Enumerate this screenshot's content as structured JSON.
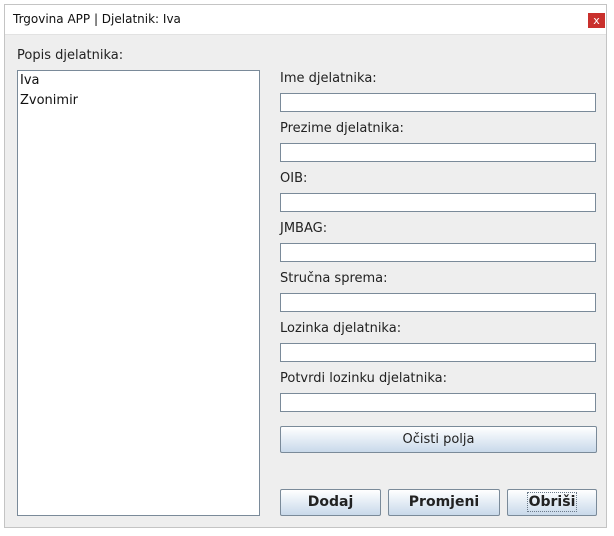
{
  "window": {
    "title": "Trgovina APP | Djelatnik: Iva",
    "close_glyph": "x"
  },
  "list": {
    "label": "Popis djelatnika:",
    "items": [
      "Iva",
      "Zvonimir"
    ]
  },
  "form": {
    "fields": [
      {
        "label": "Ime djelatnika:",
        "value": ""
      },
      {
        "label": "Prezime djelatnika:",
        "value": ""
      },
      {
        "label": "OIB:",
        "value": ""
      },
      {
        "label": "JMBAG:",
        "value": ""
      },
      {
        "label": "Stručna sprema:",
        "value": ""
      },
      {
        "label": "Lozinka djelatnika:",
        "value": ""
      },
      {
        "label": "Potvrdi lozinku djelatnika:",
        "value": ""
      }
    ],
    "clear_label": "Očisti polja"
  },
  "actions": {
    "add_label": "Dodaj",
    "change_label": "Promjeni",
    "delete_label": "Obriši"
  }
}
